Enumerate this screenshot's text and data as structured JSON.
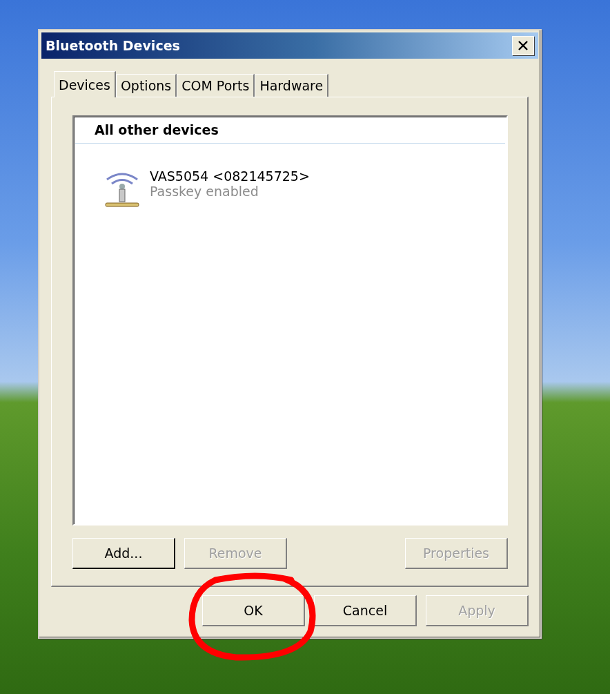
{
  "window": {
    "title": "Bluetooth Devices"
  },
  "tabs": [
    {
      "label": "Devices",
      "selected": true
    },
    {
      "label": "Options",
      "selected": false
    },
    {
      "label": "COM Ports",
      "selected": false
    },
    {
      "label": "Hardware",
      "selected": false
    }
  ],
  "list": {
    "group_header": "All other devices",
    "devices": [
      {
        "name": "VAS5054 <082145725>",
        "status": "Passkey enabled"
      }
    ]
  },
  "list_buttons": [
    {
      "label": "Add...",
      "disabled": false
    },
    {
      "label": "Remove",
      "disabled": true
    },
    {
      "label": "Properties",
      "disabled": true
    }
  ],
  "dialog_buttons": [
    {
      "label": "OK",
      "disabled": false
    },
    {
      "label": "Cancel",
      "disabled": false
    },
    {
      "label": "Apply",
      "disabled": true
    }
  ]
}
